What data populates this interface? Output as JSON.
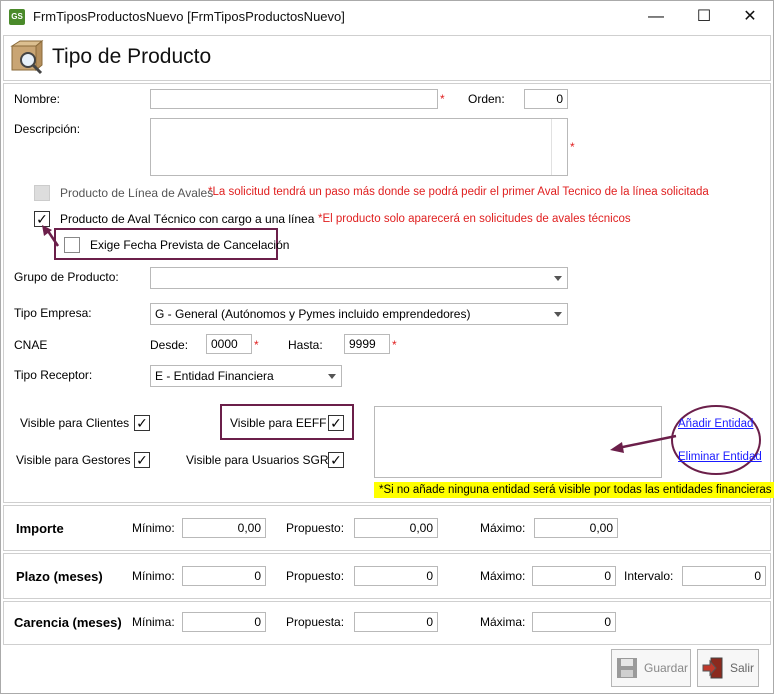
{
  "window": {
    "title": "FrmTiposProductosNuevo [FrmTiposProductosNuevo]",
    "app_icon": "GS",
    "minimize": "—",
    "maximize": "☐",
    "close": "✕"
  },
  "header": {
    "title": "Tipo de Producto",
    "icon": "box-magnifier-icon"
  },
  "form": {
    "nombre_label": "Nombre:",
    "nombre_value": "",
    "orden_label": "Orden:",
    "orden_value": "0",
    "descripcion_label": "Descripción:",
    "descripcion_value": "",
    "required_mark": "*",
    "linea_avales_label": "Producto de Línea de Avales",
    "linea_avales_note": "*La solicitud tendrá un paso más donde se podrá pedir el primer Aval Tecnico de la línea solicitada",
    "aval_tecnico_label": "Producto de Aval Técnico con cargo a una línea",
    "aval_tecnico_note": "*El producto solo aparecerá en solicitudes de avales técnicos",
    "aval_tecnico_checked": true,
    "fecha_prevista_label": "Exige Fecha Prevista de Cancelación",
    "fecha_prevista_checked": false,
    "grupo_label": "Grupo de Producto:",
    "grupo_value": "",
    "tipo_empresa_label": "Tipo Empresa:",
    "tipo_empresa_value": "G - General (Autónomos y Pymes incluido emprendedores)",
    "cnae_label": "CNAE",
    "desde_label": "Desde:",
    "desde_value": "0000",
    "hasta_label": "Hasta:",
    "hasta_value": "9999",
    "tipo_receptor_label": "Tipo Receptor:",
    "tipo_receptor_value": "E - Entidad Financiera",
    "visible_clientes_label": "Visible para Clientes",
    "visible_eeff_label": "Visible para EEFF",
    "visible_gestores_label": "Visible para Gestores",
    "visible_usuarios_sgr_label": "Visible para Usuarios SGR",
    "check_mark": "✓",
    "anadir_entidad": "Añadir Entidad",
    "eliminar_entidad": "Eliminar Entidad",
    "entidades_note": "*Si no añade ninguna entidad será visible por todas las entidades financieras"
  },
  "importe": {
    "title": "Importe",
    "minimo_label": "Mínimo:",
    "minimo_value": "0,00",
    "propuesto_label": "Propuesto:",
    "propuesto_value": "0,00",
    "maximo_label": "Máximo:",
    "maximo_value": "0,00"
  },
  "plazo": {
    "title": "Plazo (meses)",
    "minimo_label": "Mínimo:",
    "minimo_value": "0",
    "propuesto_label": "Propuesto:",
    "propuesto_value": "0",
    "maximo_label": "Máximo:",
    "maximo_value": "0",
    "intervalo_label": "Intervalo:",
    "intervalo_value": "0"
  },
  "carencia": {
    "title": "Carencia (meses)",
    "minima_label": "Mínima:",
    "minima_value": "0",
    "propuesta_label": "Propuesta:",
    "propuesta_value": "0",
    "maxima_label": "Máxima:",
    "maxima_value": "0"
  },
  "buttons": {
    "guardar": "Guardar",
    "salir": "Salir"
  },
  "colors": {
    "required": "#e02020",
    "highlight": "#6b1f4a",
    "note_bg": "#ffff00",
    "link": "#1a1aff"
  }
}
